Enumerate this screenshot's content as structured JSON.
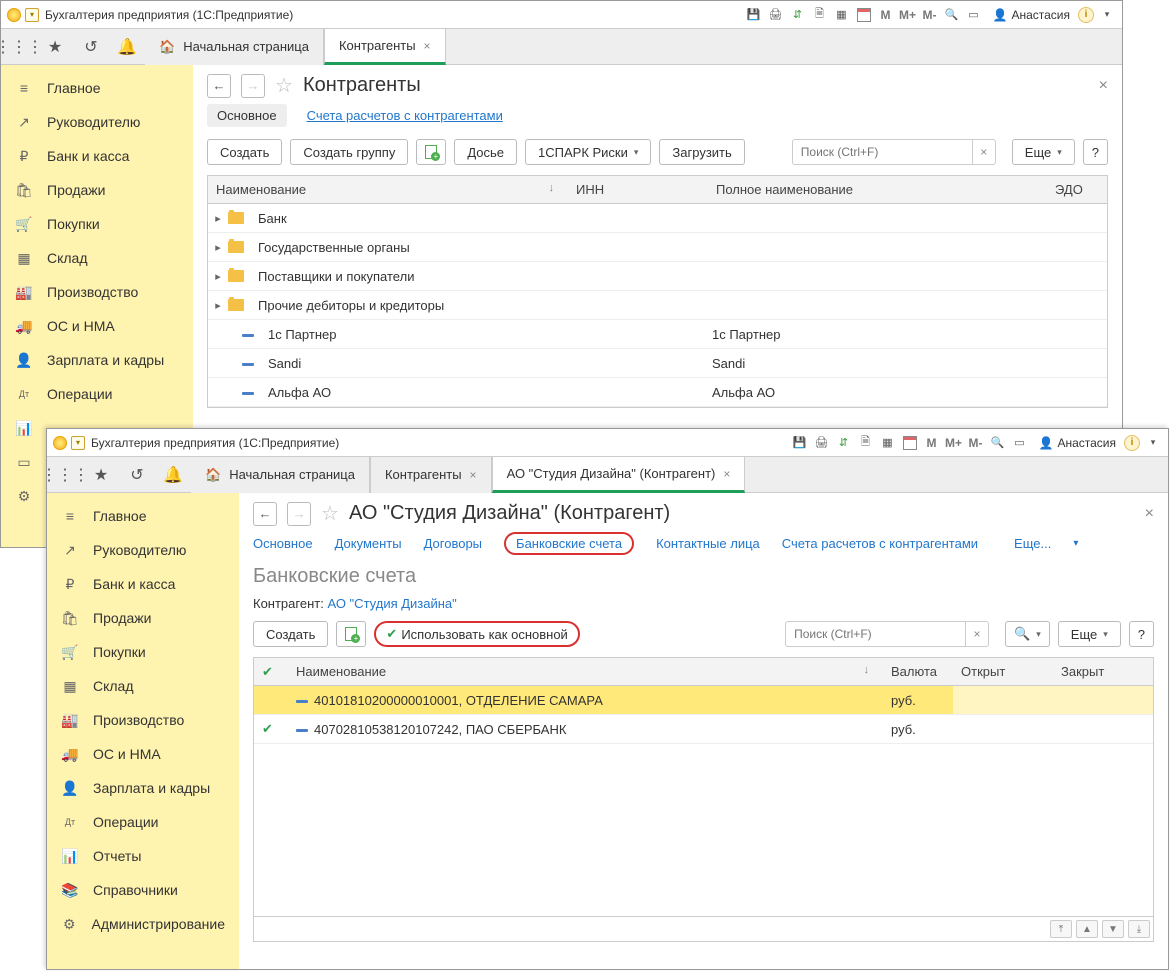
{
  "win1": {
    "title": "Бухгалтерия предприятия  (1С:Предприятие)",
    "user": "Анастасия",
    "tabs": {
      "home": "Начальная страница",
      "t1": "Контрагенты"
    },
    "sidebar": [
      {
        "icon": "≡",
        "label": "Главное"
      },
      {
        "icon": "↗",
        "label": "Руководителю"
      },
      {
        "icon": "₽",
        "label": "Банк и касса"
      },
      {
        "icon": "🛍",
        "label": "Продажи"
      },
      {
        "icon": "🛒",
        "label": "Покупки"
      },
      {
        "icon": "▦",
        "label": "Склад"
      },
      {
        "icon": "🏭",
        "label": "Производство"
      },
      {
        "icon": "🚚",
        "label": "ОС и НМА"
      },
      {
        "icon": "👤",
        "label": "Зарплата и кадры"
      },
      {
        "icon": "Дт",
        "label": "Операции"
      },
      {
        "icon": "▮",
        "label": ""
      },
      {
        "icon": "▭",
        "label": ""
      },
      {
        "icon": "⚙",
        "label": ""
      }
    ],
    "page": {
      "title": "Контрагенты",
      "sub": [
        "Основное",
        "Счета расчетов с контрагентами"
      ],
      "toolbar": {
        "create": "Создать",
        "group": "Создать группу",
        "dossier": "Досье",
        "spark": "1СПАРК Риски",
        "load": "Загрузить",
        "more": "Еще",
        "search": "Поиск (Ctrl+F)"
      },
      "cols": {
        "name": "Наименование",
        "inn": "ИНН",
        "full": "Полное наименование",
        "edo": "ЭДО"
      },
      "rows": [
        {
          "t": "f",
          "name": "Банк"
        },
        {
          "t": "f",
          "name": "Государственные органы"
        },
        {
          "t": "f",
          "name": "Поставщики и покупатели"
        },
        {
          "t": "f",
          "name": "Прочие дебиторы и кредиторы"
        },
        {
          "t": "i",
          "name": "1с Партнер",
          "full": "1с Партнер"
        },
        {
          "t": "i",
          "name": "Sandi",
          "full": "Sandi"
        },
        {
          "t": "i",
          "name": "Альфа АО",
          "full": "Альфа АО"
        }
      ]
    }
  },
  "win2": {
    "title": "Бухгалтерия предприятия  (1С:Предприятие)",
    "user": "Анастасия",
    "tabs": {
      "home": "Начальная страница",
      "t1": "Контрагенты",
      "t2": "АО \"Студия Дизайна\" (Контрагент)"
    },
    "sidebar": [
      {
        "icon": "≡",
        "label": "Главное"
      },
      {
        "icon": "↗",
        "label": "Руководителю"
      },
      {
        "icon": "₽",
        "label": "Банк и касса"
      },
      {
        "icon": "🛍",
        "label": "Продажи"
      },
      {
        "icon": "🛒",
        "label": "Покупки"
      },
      {
        "icon": "▦",
        "label": "Склад"
      },
      {
        "icon": "🏭",
        "label": "Производство"
      },
      {
        "icon": "🚚",
        "label": "ОС и НМА"
      },
      {
        "icon": "👤",
        "label": "Зарплата и кадры"
      },
      {
        "icon": "Дт",
        "label": "Операции"
      },
      {
        "icon": "📊",
        "label": "Отчеты"
      },
      {
        "icon": "📚",
        "label": "Справочники"
      },
      {
        "icon": "⚙",
        "label": "Администрирование"
      }
    ],
    "page": {
      "title": "АО \"Студия Дизайна\" (Контрагент)",
      "sub": [
        "Основное",
        "Документы",
        "Договоры",
        "Банковские счета",
        "Контактные лица",
        "Счета расчетов с контрагентами",
        "Еще..."
      ],
      "heading": "Банковские счета",
      "kvlabel": "Контрагент:",
      "kvval": "АО \"Студия Дизайна\"",
      "toolbar": {
        "create": "Создать",
        "main": "Использовать как основной",
        "more": "Еще",
        "search": "Поиск (Ctrl+F)"
      },
      "cols": {
        "name": "Наименование",
        "cur": "Валюта",
        "open": "Открыт",
        "close": "Закрыт"
      },
      "rows": [
        {
          "sel": true,
          "name": "40101810200000010001, ОТДЕЛЕНИЕ САМАРА",
          "cur": "руб."
        },
        {
          "sel": false,
          "name": "40702810538120107242, ПАО СБЕРБАНК",
          "cur": "руб."
        }
      ]
    }
  }
}
